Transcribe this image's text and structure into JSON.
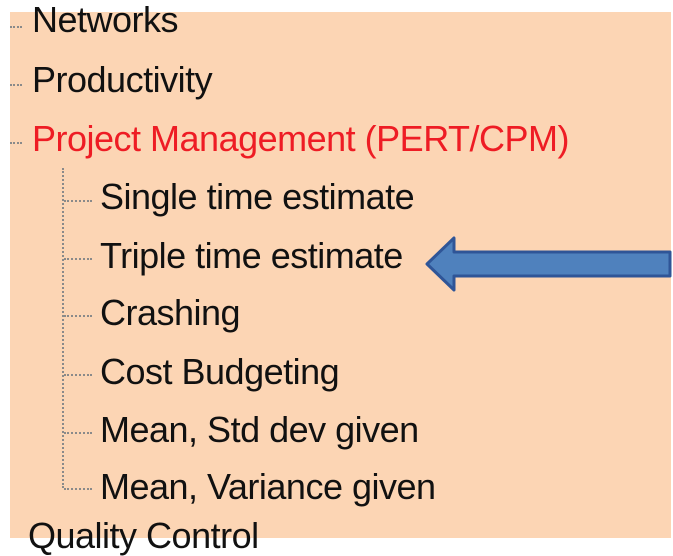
{
  "tree": {
    "top_items": [
      {
        "label": "Networks"
      },
      {
        "label": "Productivity"
      },
      {
        "label": "Project Management (PERT/CPM)",
        "selected": true
      }
    ],
    "children": [
      {
        "label": "Single time estimate"
      },
      {
        "label": "Triple time estimate"
      },
      {
        "label": "Crashing"
      },
      {
        "label": "Cost Budgeting"
      },
      {
        "label": "Mean, Std dev given"
      },
      {
        "label": "Mean, Variance given"
      }
    ],
    "next_item_partial": "Quality Control"
  },
  "annotation": {
    "arrow_target": "Triple time estimate",
    "arrow_color": "#4f81bd"
  },
  "colors": {
    "background": "#fcd5b4",
    "selected_text": "#ee1c24",
    "text": "#111111"
  }
}
